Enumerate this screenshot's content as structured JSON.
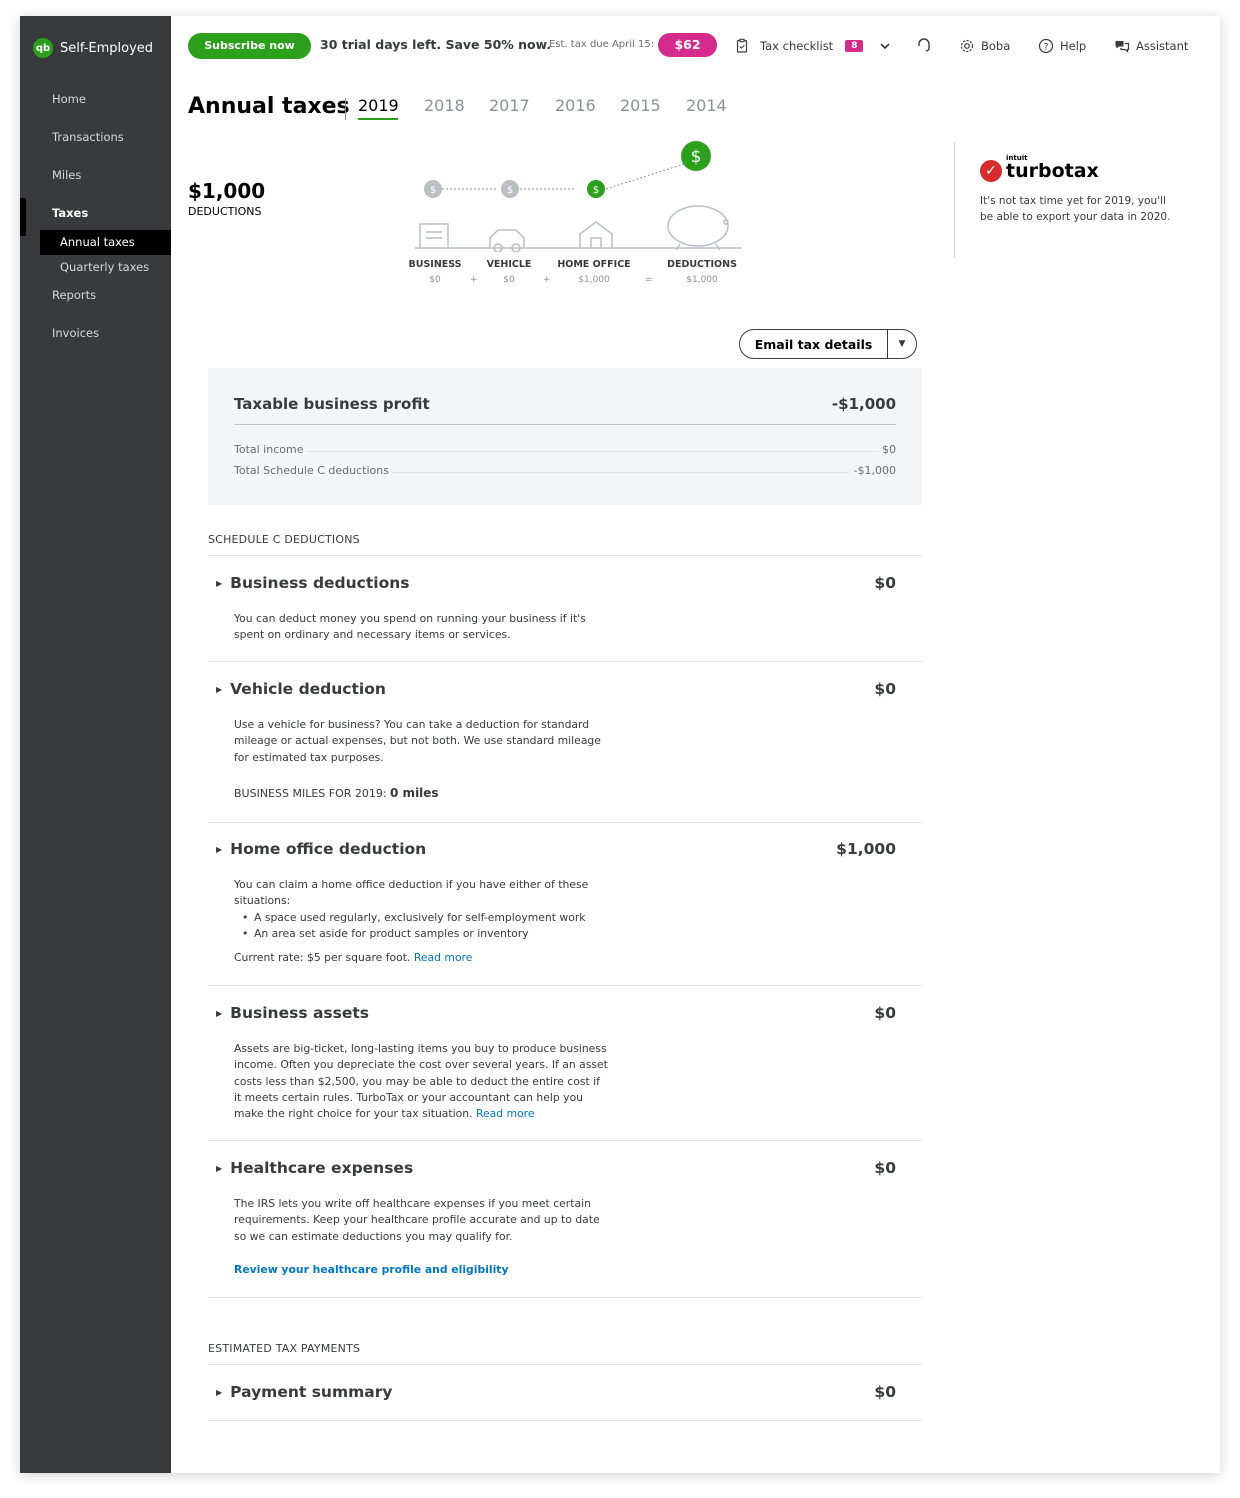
{
  "brand": {
    "logo": "qb",
    "name": "Self-Employed"
  },
  "sidebar": {
    "items": [
      {
        "label": "Home"
      },
      {
        "label": "Transactions"
      },
      {
        "label": "Miles"
      },
      {
        "label": "Taxes"
      },
      {
        "label": "Reports"
      },
      {
        "label": "Invoices"
      }
    ],
    "sub_items": [
      {
        "label": "Annual taxes"
      },
      {
        "label": "Quarterly taxes"
      }
    ]
  },
  "topbar": {
    "subscribe_label": "Subscribe now",
    "trial_text": "30 trial days left. Save 50% now.",
    "est_tax_label": "Est. tax due April 15:",
    "est_tax_value": "$62",
    "tax_checklist_label": "Tax checklist",
    "tax_checklist_count": "8",
    "user_label": "Boba",
    "help_label": "Help",
    "assistant_label": "Assistant"
  },
  "header": {
    "title": "Annual taxes",
    "years": [
      "2019",
      "2018",
      "2017",
      "2016",
      "2015",
      "2014"
    ],
    "selected_year": "2019"
  },
  "summary": {
    "amount": "$1,000",
    "label": "DEDUCTIONS",
    "steps": [
      {
        "label": "BUSINESS",
        "value": "$0"
      },
      {
        "label": "VEHICLE",
        "value": "$0"
      },
      {
        "label": "HOME OFFICE",
        "value": "$1,000"
      },
      {
        "label": "DEDUCTIONS",
        "value": "$1,000"
      }
    ],
    "operators": [
      "+",
      "+",
      "="
    ],
    "coin_symbol": "$"
  },
  "turbotax": {
    "intuit": "intuit",
    "name": "turbotax",
    "message": "It's not tax time yet for 2019, you'll be able to export your data in 2020."
  },
  "email_button": {
    "label": "Email tax details"
  },
  "profit": {
    "title": "Taxable business profit",
    "value": "-$1,000",
    "rows": [
      {
        "label": "Total income",
        "value": "$0"
      },
      {
        "label": "Total Schedule C deductions",
        "value": "-$1,000"
      }
    ]
  },
  "schedule_c": {
    "heading": "SCHEDULE C DEDUCTIONS",
    "business": {
      "title": "Business deductions",
      "amount": "$0",
      "desc": "You can deduct money you spend on running your business if it's spent on ordinary and necessary items or services."
    },
    "vehicle": {
      "title": "Vehicle deduction",
      "amount": "$0",
      "desc": "Use a vehicle for business? You can take a deduction for standard mileage or actual expenses, but not both. We use standard mileage for estimated tax purposes.",
      "miles_label": "BUSINESS MILES FOR 2019:",
      "miles_value": "0 miles"
    },
    "home_office": {
      "title": "Home office deduction",
      "amount": "$1,000",
      "desc": "You can claim a home office deduction if you have either of these situations:",
      "bullets": [
        "A space used regularly, exclusively for self-employment work",
        "An area set aside for product samples or inventory"
      ],
      "rate_text": "Current rate: $5 per square foot.",
      "read_more": "Read more"
    },
    "assets": {
      "title": "Business assets",
      "amount": "$0",
      "desc": "Assets are big-ticket, long-lasting items you buy to produce business income. Often you depreciate the cost over several years. If an asset costs less than $2,500, you may be able to deduct the entire cost if it meets certain rules. TurboTax or your accountant can help you make the right choice for your tax situation.",
      "read_more": "Read more"
    },
    "healthcare": {
      "title": "Healthcare expenses",
      "amount": "$0",
      "desc": "The IRS lets you write off healthcare expenses if you meet certain requirements. Keep your healthcare profile accurate and up to date so we can estimate deductions you may qualify for.",
      "link": "Review your healthcare profile and eligibility"
    }
  },
  "estimated": {
    "heading": "ESTIMATED TAX PAYMENTS",
    "payment": {
      "title": "Payment summary",
      "amount": "$0"
    }
  },
  "colors": {
    "brand_green": "#2ca01c",
    "accent_pink": "#d52b8d",
    "link_blue": "#0077c5",
    "sidebar": "#393a3d"
  },
  "icons": [
    "clipboard-icon",
    "chevron-down-icon",
    "headset-icon",
    "gear-icon",
    "help-icon",
    "chat-icon",
    "caret-right-icon"
  ]
}
